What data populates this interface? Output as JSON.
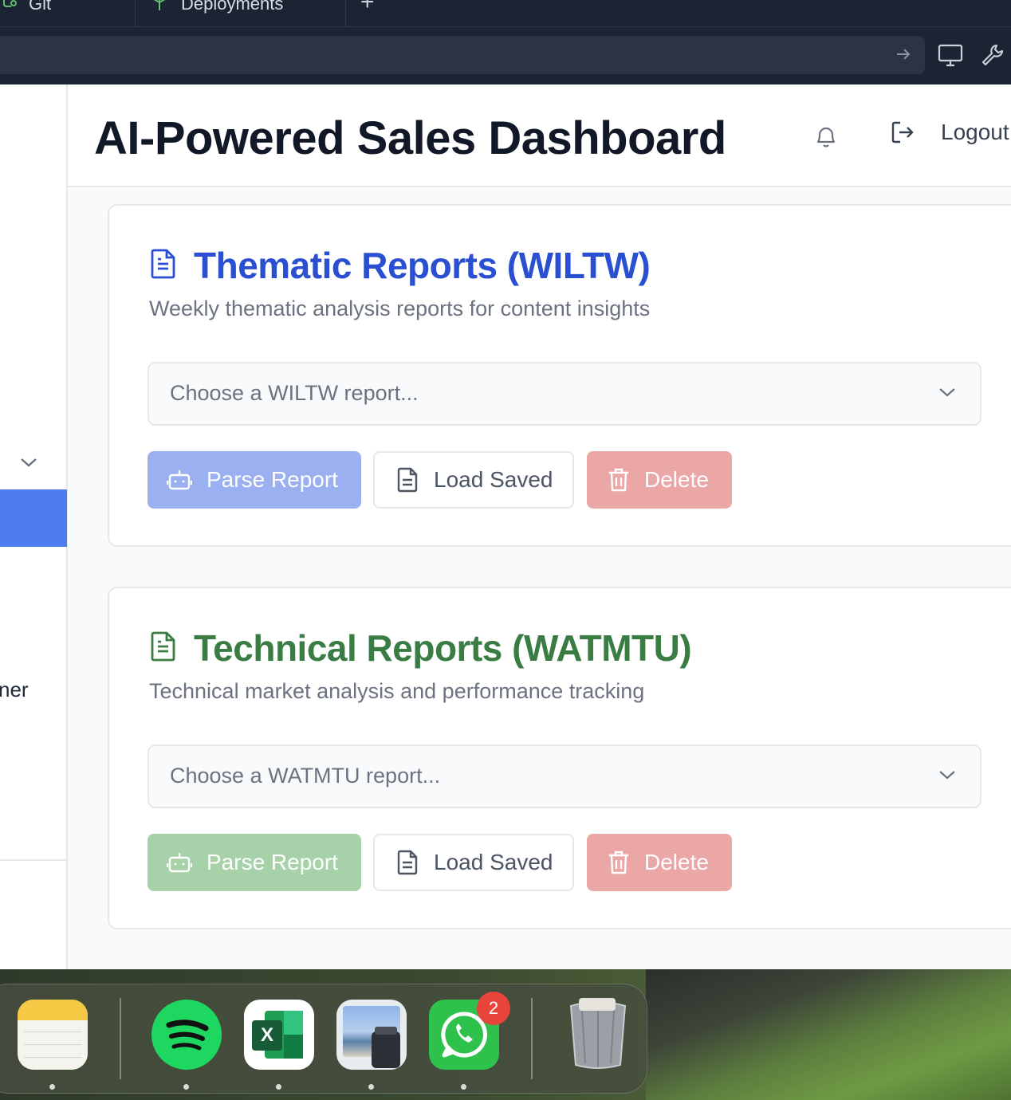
{
  "browser": {
    "tabs": [
      {
        "label": "Git",
        "icon": "git-branch-icon"
      },
      {
        "label": "Deployments",
        "icon": "deploy-icon"
      }
    ],
    "new_tab_label": "+"
  },
  "sidebar": {
    "partial_item_text": "ner"
  },
  "header": {
    "title": "AI-Powered Sales Dashboard",
    "logout_label": "Logout"
  },
  "sections": [
    {
      "title": "Thematic Reports (WILTW)",
      "subtitle": "Weekly thematic analysis reports for content insights",
      "select_placeholder": "Choose a WILTW report...",
      "parse_label": "Parse Report",
      "load_label": "Load Saved",
      "delete_label": "Delete",
      "accent": "#2b4fd1"
    },
    {
      "title": "Technical Reports (WATMTU)",
      "subtitle": "Technical market analysis and performance tracking",
      "select_placeholder": "Choose a WATMTU report...",
      "parse_label": "Parse Report",
      "load_label": "Load Saved",
      "delete_label": "Delete",
      "accent": "#3a7d44"
    }
  ],
  "dock": {
    "apps": [
      "Notes",
      "Spotify",
      "Excel",
      "Preview",
      "WhatsApp",
      "Trash"
    ],
    "whatsapp_badge": "2",
    "excel_letter": "X"
  }
}
